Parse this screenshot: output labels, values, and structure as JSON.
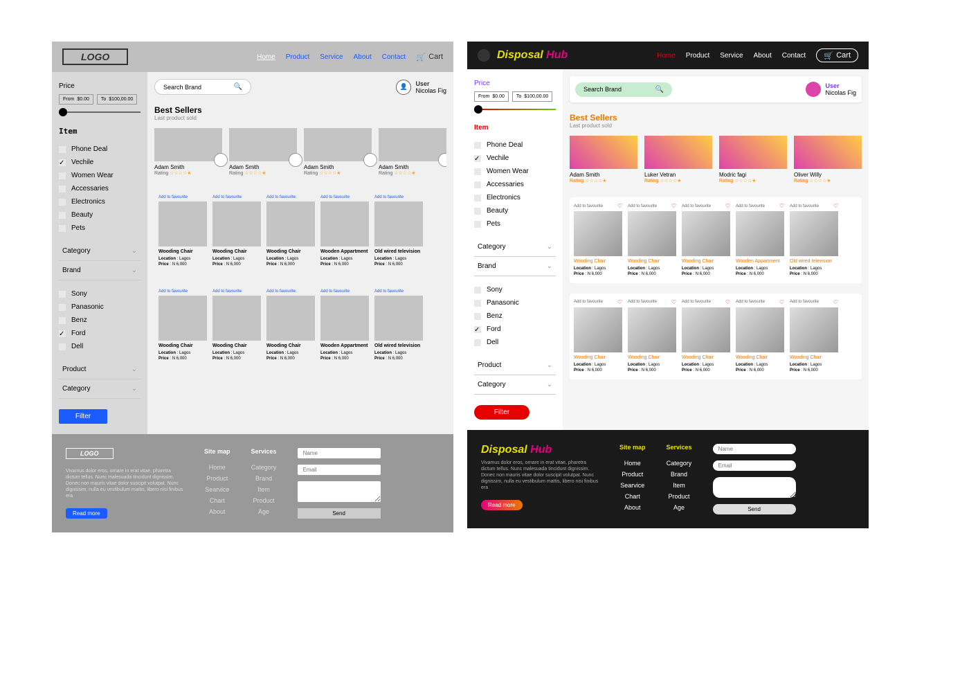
{
  "logo_gray": "LOGO",
  "logo_color_1": "Disposal",
  "logo_color_2": "Hub",
  "nav": [
    "Home",
    "Product",
    "Service",
    "About",
    "Contact"
  ],
  "cart_label": "Cart",
  "search_placeholder": "Search Brand",
  "user_label": "User",
  "user_name": "Nicolas Fig",
  "sidebar": {
    "price_label": "Price",
    "from_label": "From",
    "from_value": "$0.00",
    "to_label": "To",
    "to_value": "$100,00.00",
    "item_label": "Item",
    "items": [
      {
        "label": "Phone Deal",
        "checked": false
      },
      {
        "label": "Vechile",
        "checked": true
      },
      {
        "label": "Women Wear",
        "checked": false
      },
      {
        "label": "Accessaries",
        "checked": false
      },
      {
        "label": "Electronics",
        "checked": false
      },
      {
        "label": "Beauty",
        "checked": false
      },
      {
        "label": "Pets",
        "checked": false
      }
    ],
    "items_color": [
      {
        "label": "Phone Deal",
        "checked": false
      },
      {
        "label": "Vechile",
        "checked": true
      },
      {
        "label": "Women Wear",
        "checked": false
      },
      {
        "label": "Accessaries",
        "checked": false
      },
      {
        "label": "Electronics",
        "checked": false
      },
      {
        "label": "Beauty",
        "checked": false
      },
      {
        "label": "Pets",
        "checked": false
      }
    ],
    "dropdowns1": [
      "Category",
      "Brand"
    ],
    "brands": [
      {
        "label": "Sony",
        "checked": false
      },
      {
        "label": "Panasonic",
        "checked": false
      },
      {
        "label": "Benz",
        "checked": false
      },
      {
        "label": "Ford",
        "checked": true
      },
      {
        "label": "Dell",
        "checked": false
      }
    ],
    "dropdowns2": [
      "Product",
      "Category"
    ],
    "filter_label": "Filter"
  },
  "best_sellers_title": "Best Sellers",
  "best_sellers_sub": "Last product sold",
  "sellers_gray": [
    {
      "name": "Adam  Smith",
      "rating": "Rating"
    },
    {
      "name": "Adam  Smith",
      "rating": "Rating"
    },
    {
      "name": "Adam  Smith",
      "rating": "Rating"
    },
    {
      "name": "Adam  Smith",
      "rating": "Rating"
    }
  ],
  "sellers_color": [
    {
      "name": "Adam Smith",
      "rating": "Rating"
    },
    {
      "name": "Luker Vetran",
      "rating": "Rating"
    },
    {
      "name": "Modric fagi",
      "rating": "Rating"
    },
    {
      "name": "Oliver Willy",
      "rating": "Rating"
    }
  ],
  "fav_label": "Add to favourite",
  "products_row1": [
    {
      "name": "Wooding Chair",
      "loc": "Lagos",
      "price": "N 6,000"
    },
    {
      "name": "Wooding Chair",
      "loc": "Lagos",
      "price": "N 6,000"
    },
    {
      "name": "Wooding Chair",
      "loc": "Lagos",
      "price": "N 6,000"
    },
    {
      "name": "Wooden Appartment",
      "loc": "Lagos",
      "price": "N 6,000"
    },
    {
      "name": "Old wired  television",
      "loc": "Lagos",
      "price": "N 6,000"
    }
  ],
  "products_row2": [
    {
      "name": "Wooding Chair",
      "loc": "Lagos",
      "price": "N 6,000"
    },
    {
      "name": "Wooding Chair",
      "loc": "Lagos",
      "price": "N 6,000"
    },
    {
      "name": "Wooding Chair",
      "loc": "Lagos",
      "price": "N 6,000"
    },
    {
      "name": "Wooden Appartment",
      "loc": "Lagos",
      "price": "N 6,000"
    },
    {
      "name": "Old wired  television",
      "loc": "Lagos",
      "price": "N 6,000"
    }
  ],
  "products_color_row2": [
    {
      "name": "Wooding Chair",
      "loc": "Lagos",
      "price": "N 6,000"
    },
    {
      "name": "Wooding Chair",
      "loc": "Lagos",
      "price": "N 6,000"
    },
    {
      "name": "Wooding Chair",
      "loc": "Lagos",
      "price": "N 6,000"
    },
    {
      "name": "Wooding Chair",
      "loc": "Lagos",
      "price": "N 6,000"
    },
    {
      "name": "Wooding Chair",
      "loc": "Lagos",
      "price": "N 6,000"
    }
  ],
  "loc_label": "Location",
  "price_label_p": "Price",
  "footer": {
    "desc_gray": "Vivamus dolor eros, ornare in erat vitae, pharetra dictum tellus. Nunc malesuada tincidunt dignissim. Donec non mauris vitae dolor suscipit volutpat. Nunc dignissim, nulla eu vestibulum mattis, libero nisi finibus era",
    "desc_color": "Vivamus dolor eros, ornare in erat vitae, pharetra dictum tellus. Nunc malesuada tincidunt dignissim. Donec non mauris vitae dolor suscipit volutpat. Nunc dignissim, nulla eu vestibulum mattis, libero nisi finibus era",
    "read_more": "Read more",
    "sitemap_h": "Site map",
    "sitemap": [
      "Home",
      "Product",
      "Searvice",
      "Chart",
      "About"
    ],
    "services_h": "Services",
    "services": [
      "Category",
      "Brand",
      "Item",
      "Product",
      "Age"
    ],
    "name_ph": "Name",
    "email_ph": "Email",
    "send": "Send"
  }
}
